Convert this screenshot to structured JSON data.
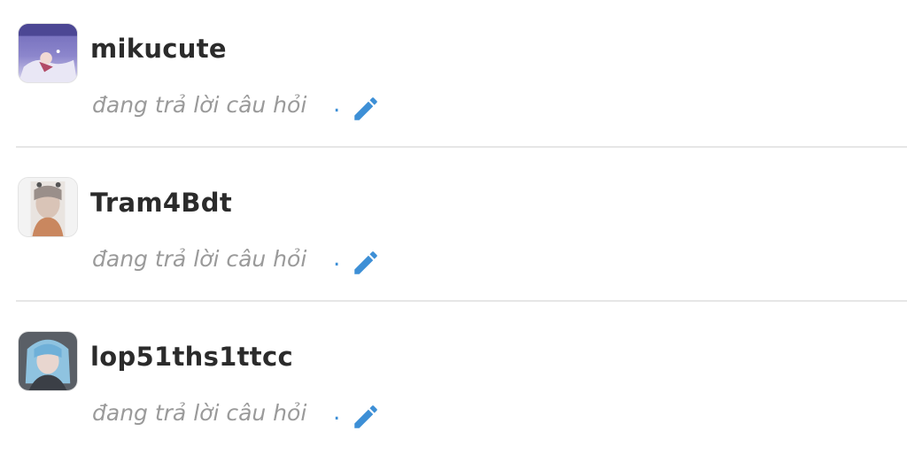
{
  "users": [
    {
      "username": "mikucute",
      "status": "đang trả lời câu hỏi",
      "dot": "."
    },
    {
      "username": "Tram4Bdt",
      "status": "đang trả lời câu hỏi",
      "dot": "."
    },
    {
      "username": "lop51ths1ttcc",
      "status": "đang trả lời câu hỏi",
      "dot": "."
    }
  ],
  "icons": {
    "edit": "pencil-icon"
  },
  "colors": {
    "username": "#2b2b2b",
    "status": "#9a9a9a",
    "accent": "#3d8fd6",
    "divider": "#e6e6e6"
  }
}
